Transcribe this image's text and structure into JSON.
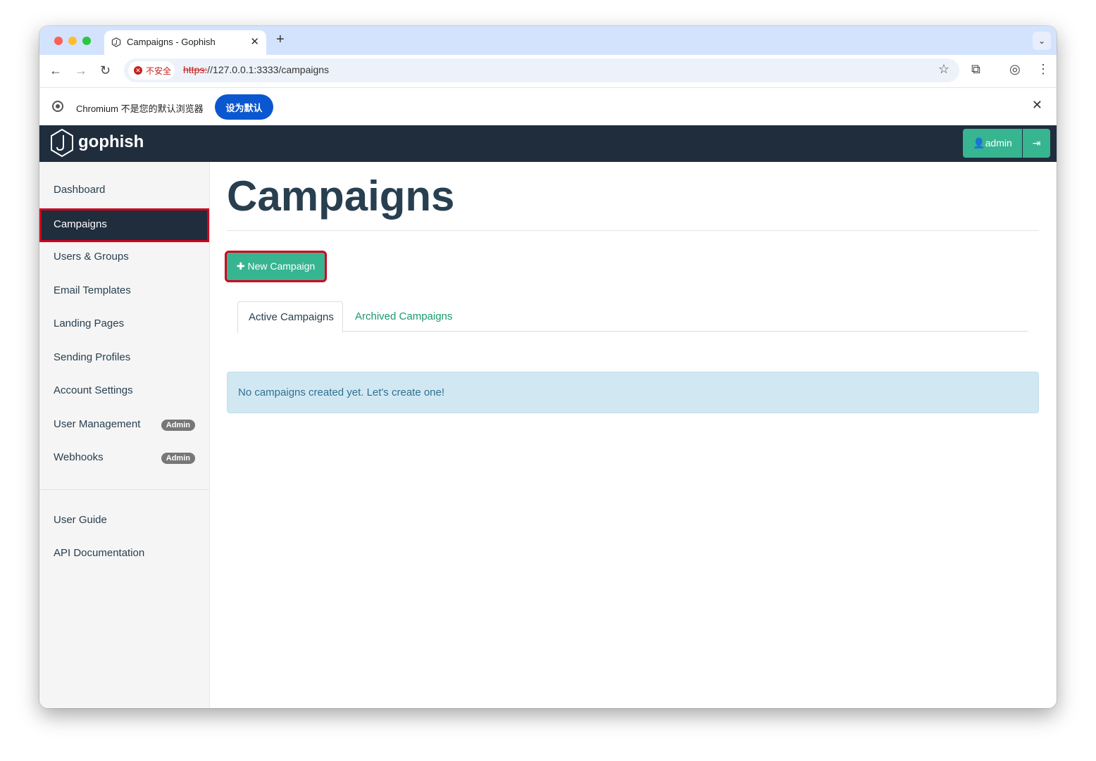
{
  "browser": {
    "tab_title": "Campaigns - Gophish",
    "new_tab_icon": "plus-icon",
    "security_label": "不安全",
    "url_scheme": "https:",
    "url_rest": "//127.0.0.1:3333/campaigns",
    "infobar_text": "Chromium 不是您的默认浏览器",
    "infobar_button": "设为默认"
  },
  "navbar": {
    "brand": "gophish",
    "user_label": "admin",
    "accent_color": "#37b590",
    "background_color": "#1f2d3d"
  },
  "sidebar": {
    "items": [
      {
        "label": "Dashboard"
      },
      {
        "label": "Campaigns",
        "active": true
      },
      {
        "label": "Users & Groups"
      },
      {
        "label": "Email Templates"
      },
      {
        "label": "Landing Pages"
      },
      {
        "label": "Sending Profiles"
      },
      {
        "label": "Account Settings"
      },
      {
        "label": "User Management",
        "badge": "Admin"
      },
      {
        "label": "Webhooks",
        "badge": "Admin"
      }
    ],
    "secondary": [
      {
        "label": "User Guide"
      },
      {
        "label": "API Documentation"
      }
    ]
  },
  "main": {
    "title": "Campaigns",
    "new_campaign_label": "New Campaign",
    "tabs": [
      {
        "label": "Active Campaigns",
        "active": true
      },
      {
        "label": "Archived Campaigns"
      }
    ],
    "empty_message": "No campaigns created yet. Let's create one!"
  }
}
